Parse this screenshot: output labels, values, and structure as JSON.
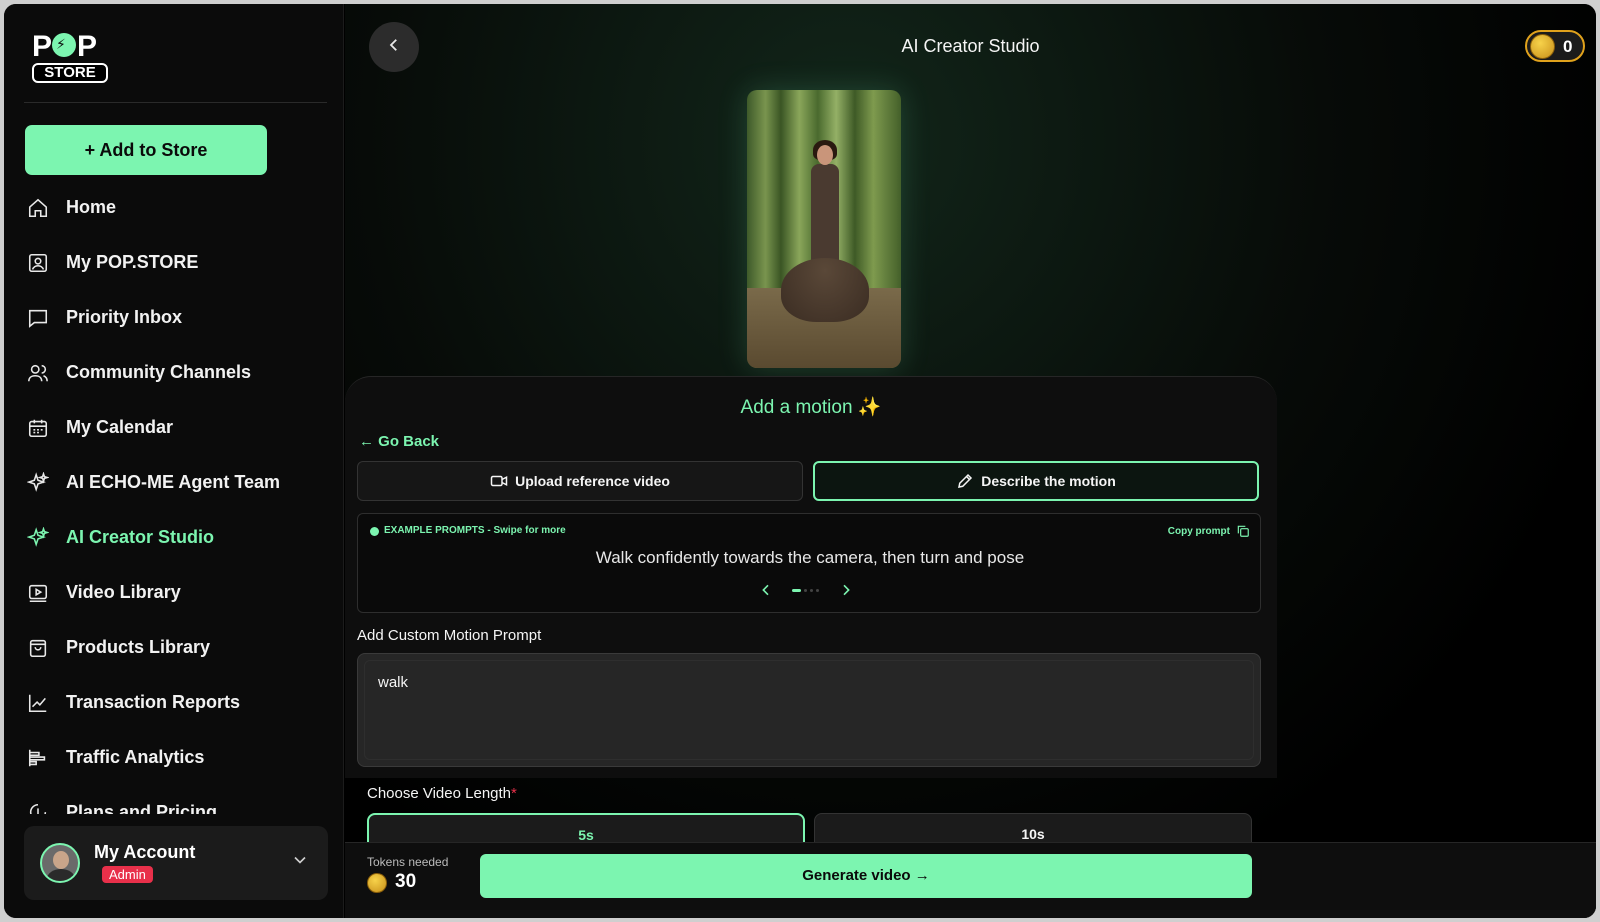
{
  "sidebar": {
    "logo": {
      "pop": "POP",
      "store": "STORE"
    },
    "add_button": "+ Add to Store",
    "items": [
      {
        "label": "Home",
        "icon": "home-icon",
        "active": false
      },
      {
        "label": "My POP.STORE",
        "icon": "store-profile-icon",
        "active": false
      },
      {
        "label": "Priority Inbox",
        "icon": "chat-bubble-icon",
        "active": false
      },
      {
        "label": "Community Channels",
        "icon": "users-icon",
        "active": false
      },
      {
        "label": "My Calendar",
        "icon": "calendar-icon",
        "active": false
      },
      {
        "label": "AI ECHO-ME Agent Team",
        "icon": "sparkles-icon",
        "active": false
      },
      {
        "label": "AI Creator Studio",
        "icon": "sparkles-icon",
        "active": true
      },
      {
        "label": "Video Library",
        "icon": "video-library-icon",
        "active": false
      },
      {
        "label": "Products Library",
        "icon": "shopping-bag-icon",
        "active": false
      },
      {
        "label": "Transaction Reports",
        "icon": "line-chart-icon",
        "active": false
      },
      {
        "label": "Traffic Analytics",
        "icon": "bar-chart-icon",
        "active": false
      },
      {
        "label": "Plans and Pricing",
        "icon": "pricing-icon",
        "active": false
      }
    ],
    "account": {
      "name": "My Account",
      "badge": "Admin"
    }
  },
  "header": {
    "title": "AI Creator Studio",
    "coins": "0"
  },
  "motion": {
    "title": "Add a motion ✨",
    "go_back": "← Go Back",
    "upload_label": "Upload reference video",
    "describe_label": "Describe the motion",
    "examples_label": "EXAMPLE PROMPTS - Swipe for more",
    "copy_label": "Copy prompt",
    "example_text": "Walk confidently towards the camera, then turn and pose",
    "custom_label": "Add Custom Motion Prompt",
    "custom_value": "walk"
  },
  "video_length": {
    "label": "Choose Video Length",
    "required": "*",
    "options": [
      "5s",
      "10s"
    ],
    "selected": "5s"
  },
  "footer": {
    "tokens_label": "Tokens needed",
    "tokens_value": "30",
    "generate_label": "Generate video →"
  },
  "colors": {
    "accent": "#7cf5b0",
    "danger": "#e8304a",
    "coin": "#e0a21c",
    "background": "#000000"
  }
}
